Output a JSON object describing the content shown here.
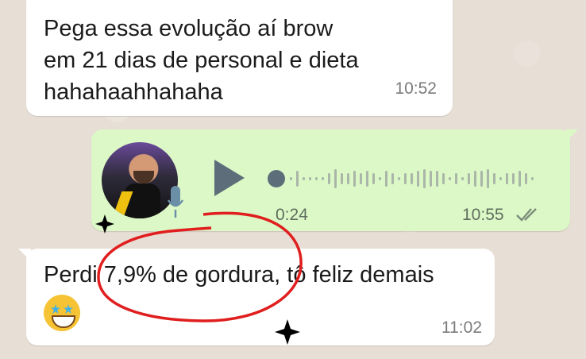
{
  "chat": {
    "messages": [
      {
        "direction": "incoming",
        "lines": [
          "Pega essa evolução aí brow",
          "em 21 dias de personal e dieta",
          "hahahaahhahaha"
        ],
        "time": "10:52"
      },
      {
        "direction": "outgoing",
        "type": "voice",
        "duration": "0:24",
        "time": "10:55",
        "status": "read"
      },
      {
        "direction": "incoming",
        "text": "Perdi 7,9% de gordura, tô feliz demais",
        "emoji": "star-struck-emoji",
        "time": "11:02"
      }
    ]
  },
  "colors": {
    "incoming_bubble": "#ffffff",
    "outgoing_bubble": "#dcf8c6",
    "annotation": "#e01e1e",
    "wallpaper": "#e7ded5"
  }
}
